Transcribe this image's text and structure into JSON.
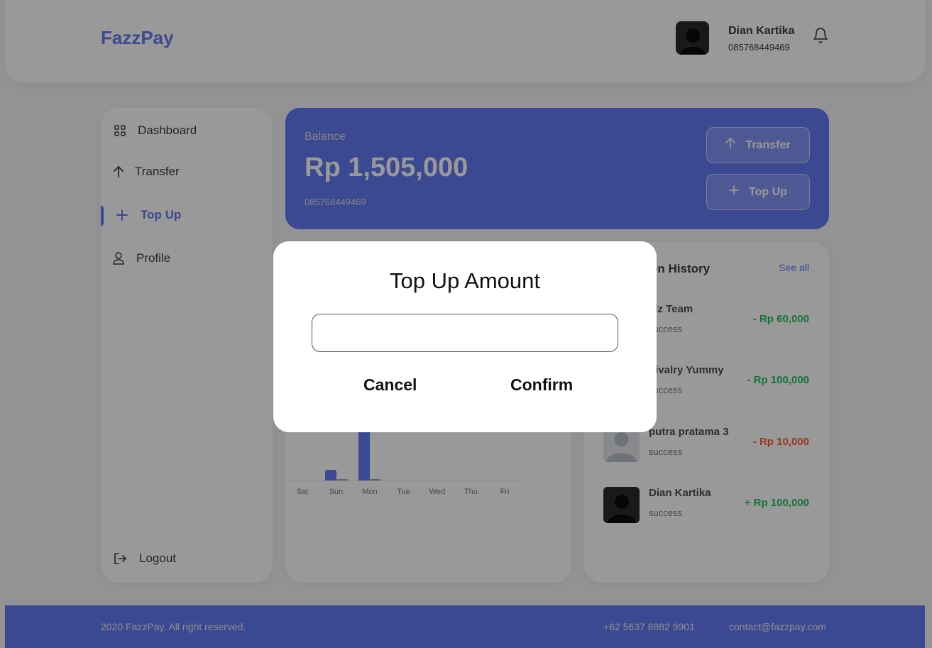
{
  "brand": {
    "name": "FazzPay"
  },
  "user": {
    "name": "Dian Kartika",
    "phone": "085768449469"
  },
  "sidebar": {
    "items": [
      {
        "label": "Dashboard",
        "icon": "grid-icon"
      },
      {
        "label": "Transfer",
        "icon": "arrow-up-icon"
      },
      {
        "label": "Top Up",
        "icon": "plus-icon",
        "active": true
      },
      {
        "label": "Profile",
        "icon": "user-icon"
      }
    ],
    "logout": "Logout"
  },
  "balance": {
    "label": "Balance",
    "value": "Rp 1,505,000",
    "phone": "085768449469",
    "transfer_label": "Transfer",
    "topup_label": "Top Up"
  },
  "chart_data": {
    "type": "bar",
    "categories": [
      "Sat",
      "Sun",
      "Mon",
      "Tue",
      "Wed",
      "Thu",
      "Fri"
    ],
    "series": [
      {
        "color": "#6379f4",
        "values": [
          0,
          6,
          100,
          0,
          0,
          0,
          0
        ]
      },
      {
        "color": "#9da6b5",
        "values": [
          0,
          1,
          1,
          0,
          0,
          0,
          0
        ]
      }
    ]
  },
  "history": {
    "title": "Transaction History",
    "title_visible": "on History",
    "see_all": "See all",
    "items": [
      {
        "name": "alz Team",
        "status": "success",
        "amount": "- Rp 60,000",
        "kind": "pos"
      },
      {
        "name": "hivalry Yummy",
        "status": "success",
        "amount": "- Rp 100,000",
        "kind": "pos"
      },
      {
        "name": "putra pratama 3",
        "status": "success",
        "amount": "- Rp 10,000",
        "kind": "neg"
      },
      {
        "name": "Dian Kartika",
        "status": "success",
        "amount": "+ Rp 100,000",
        "kind": "pos"
      }
    ]
  },
  "footer": {
    "copyright": "2020 FazzPay. All right reserved.",
    "phone": "+62 5637 8882 9901",
    "email": "contact@fazzpay.com"
  },
  "modal": {
    "title": "Top Up Amount",
    "input_value": "",
    "input_placeholder": "",
    "cancel_label": "Cancel",
    "confirm_label": "Confirm"
  }
}
